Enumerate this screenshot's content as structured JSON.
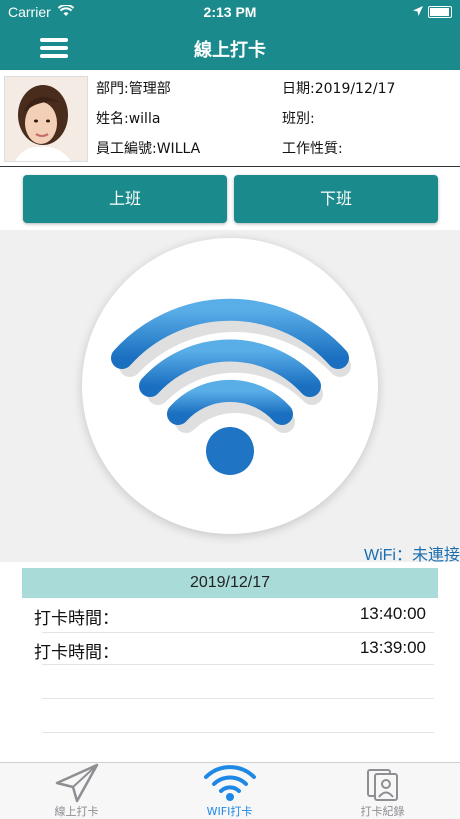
{
  "status_bar": {
    "carrier": "Carrier",
    "time": "2:13 PM"
  },
  "nav": {
    "title": "線上打卡"
  },
  "employee": {
    "department": "部門:管理部",
    "date": "日期:2019/12/17",
    "name": "姓名:willa",
    "shift": "班別:",
    "employee_id": "員工編號:WILLA",
    "job_type": "工作性質:"
  },
  "buttons": {
    "clock_in": "上班",
    "clock_out": "下班"
  },
  "wifi": {
    "status": "WiFi：未連接"
  },
  "records": {
    "date": "2019/12/17",
    "rows": [
      {
        "label": "打卡時間：",
        "time": "13:40:00"
      },
      {
        "label": "打卡時間：",
        "time": "13:39:00"
      }
    ]
  },
  "tabs": [
    {
      "label": "線上打卡",
      "icon": "send-icon"
    },
    {
      "label": "WIFI打卡",
      "icon": "wifi-icon"
    },
    {
      "label": "打卡紀錄",
      "icon": "record-icon"
    }
  ],
  "colors": {
    "primary": "#1a8a8c",
    "wifi_blue": "#1e7fd0",
    "date_bar": "#a9dcd9",
    "tab_active": "#1e88e5"
  }
}
